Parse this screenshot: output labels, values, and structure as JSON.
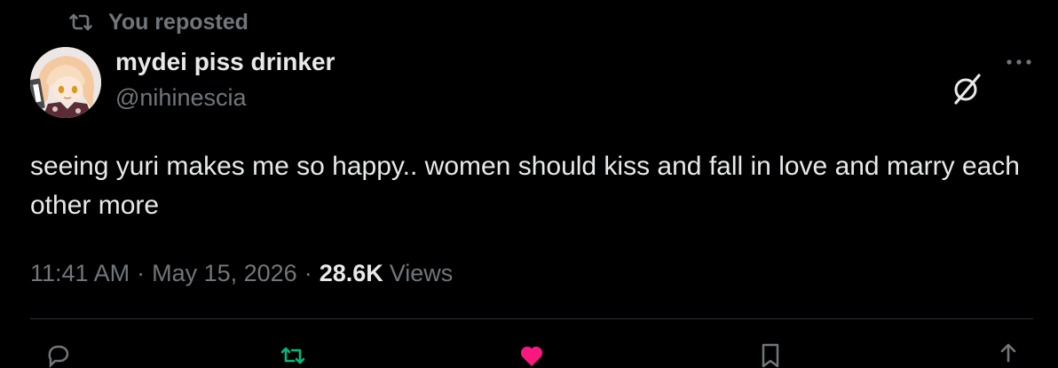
{
  "repost_header": {
    "label": "You reposted",
    "icon": "repost-icon"
  },
  "author": {
    "display_name": "mydei piss drinker",
    "handle": "@nihinescia",
    "avatar": "avatar-image"
  },
  "header_actions": {
    "grok_icon": "grok-icon",
    "more_icon": "more-icon"
  },
  "tweet": {
    "text": "seeing yuri makes me so happy.. women should kiss and fall in love and marry each other more"
  },
  "meta": {
    "time": "11:41 AM",
    "separator": "·",
    "date": "May 15, 2026",
    "views_count": "28.6K",
    "views_label": "Views"
  },
  "action_bar": [
    "reply-icon",
    "repost-icon",
    "like-icon",
    "bookmark-icon",
    "share-icon"
  ],
  "colors": {
    "background": "#000000",
    "text_primary": "#e7e9ea",
    "text_secondary": "#71767b",
    "divider": "#2f3336",
    "repost_green": "#00ba7c",
    "like_pink": "#f91880"
  }
}
